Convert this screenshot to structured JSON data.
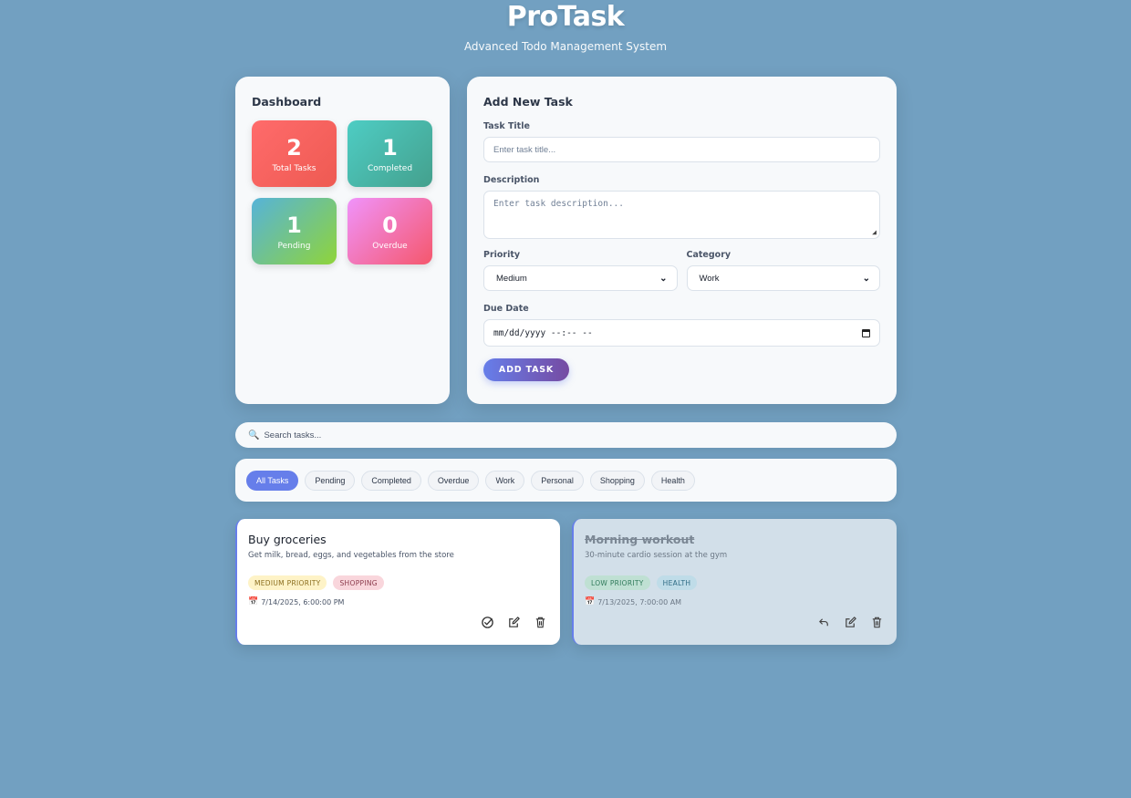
{
  "header": {
    "title": "ProTask",
    "subtitle": "Advanced Todo Management System"
  },
  "dashboard": {
    "title": "Dashboard",
    "stats": {
      "total": {
        "value": "2",
        "label": "Total Tasks",
        "color": "#ee5a52"
      },
      "completed": {
        "value": "1",
        "label": "Completed",
        "color": "#44a08d"
      },
      "pending": {
        "value": "1",
        "label": "Pending",
        "color": "#8fd43a"
      },
      "overdue": {
        "value": "0",
        "label": "Overdue",
        "color": "#f5576c"
      }
    }
  },
  "form": {
    "title": "Add New Task",
    "task_title_label": "Task Title",
    "task_title_placeholder": "Enter task title...",
    "description_label": "Description",
    "description_placeholder": "Enter task description...",
    "priority_label": "Priority",
    "priority_value": "Medium",
    "category_label": "Category",
    "category_value": "Work",
    "due_date_label": "Due Date",
    "due_date_placeholder": "mm/dd/yyyy --:-- --",
    "add_button": "ADD TASK"
  },
  "search": {
    "icon": "magnifier-icon",
    "placeholder": "Search tasks..."
  },
  "filters": {
    "active": "All Tasks",
    "items": [
      "All Tasks",
      "Pending",
      "Completed",
      "Overdue",
      "Work",
      "Personal",
      "Shopping",
      "Health"
    ]
  },
  "tasks": [
    {
      "title": "Buy groceries",
      "description": "Get milk, bread, eggs, and vegetables from the store",
      "priority_tag": "MEDIUM PRIORITY",
      "category_tag": "SHOPPING",
      "due": "7/14/2025, 6:00:00 PM",
      "completed": false,
      "actions": [
        "complete-icon",
        "edit-icon",
        "delete-icon"
      ]
    },
    {
      "title": "Morning workout",
      "description": "30-minute cardio session at the gym",
      "priority_tag": "LOW PRIORITY",
      "category_tag": "HEALTH",
      "due": "7/13/2025, 7:00:00 AM",
      "completed": true,
      "actions": [
        "undo-icon",
        "edit-icon",
        "delete-icon"
      ]
    }
  ],
  "colors": {
    "background": "#72a0c1",
    "accent": "#667eea",
    "accent_end": "#764ba2"
  }
}
